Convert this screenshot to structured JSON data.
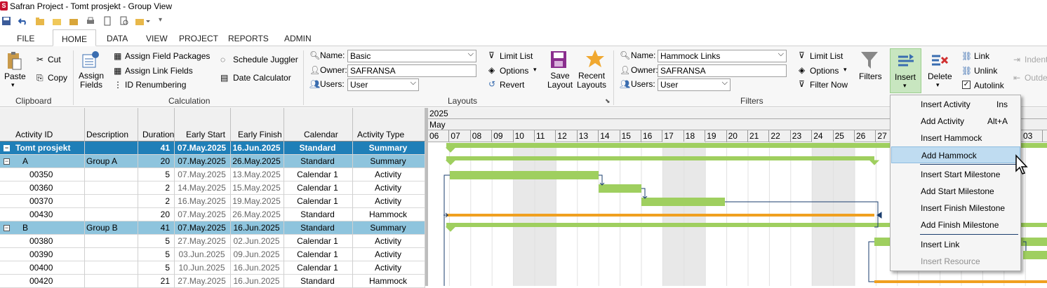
{
  "window": {
    "title": "Safran Project - Tomt prosjekt - Group View"
  },
  "tabs": [
    "FILE",
    "HOME",
    "DATA",
    "VIEW",
    "PROJECT",
    "REPORTS",
    "ADMIN"
  ],
  "active_tab": "HOME",
  "ribbon": {
    "clipboard": {
      "paste": "Paste",
      "cut": "Cut",
      "copy": "Copy",
      "group": "Clipboard"
    },
    "calculation": {
      "assign_fields": "Assign\nFields",
      "assign_field_packages": "Assign Field Packages",
      "assign_link_fields": "Assign Link Fields",
      "id_renumbering": "ID Renumbering",
      "schedule_juggler": "Schedule Juggler",
      "date_calculator": "Date Calculator",
      "group": "Calculation"
    },
    "layouts": {
      "name_label": "Name:",
      "name_value": "Basic",
      "owner_label": "Owner:",
      "owner_value": "SAFRANSA",
      "users_label": "Users:",
      "users_value": "User",
      "limit_list": "Limit List",
      "options": "Options",
      "revert": "Revert",
      "save_layout": "Save\nLayout",
      "recent_layouts": "Recent\nLayouts",
      "group": "Layouts"
    },
    "filters": {
      "name_label": "Name:",
      "name_value": "Hammock Links",
      "owner_label": "Owner:",
      "owner_value": "SAFRANSA",
      "users_label": "Users:",
      "users_value": "User",
      "limit_list": "Limit List",
      "options": "Options",
      "filter_now": "Filter Now",
      "filters": "Filters",
      "group": "Filters"
    },
    "edit": {
      "insert": "Insert",
      "delete": "Delete",
      "link": "Link",
      "unlink": "Unlink",
      "autolink": "Autolink",
      "autolink_checked": true,
      "indent": "Indent",
      "outdent": "Outde"
    }
  },
  "table": {
    "columns": [
      "Activity ID",
      "Description",
      "Duration",
      "Early Start",
      "Early Finish",
      "Calendar",
      "Activity Type"
    ],
    "rows": [
      {
        "level": 0,
        "id": "Tomt prosjekt",
        "desc": "",
        "dur": "41",
        "start": "07.May.2025",
        "finish": "16.Jun.2025",
        "cal": "Standard",
        "type": "Summary"
      },
      {
        "level": 1,
        "id": "A",
        "desc": "Group A",
        "dur": "20",
        "start": "07.May.2025",
        "finish": "26.May.2025",
        "cal": "Standard",
        "type": "Summary"
      },
      {
        "level": 2,
        "id": "00350",
        "desc": "",
        "dur": "5",
        "start": "07.May.2025",
        "finish": "13.May.2025",
        "cal": "Calendar 1",
        "type": "Activity"
      },
      {
        "level": 2,
        "id": "00360",
        "desc": "",
        "dur": "2",
        "start": "14.May.2025",
        "finish": "15.May.2025",
        "cal": "Calendar 1",
        "type": "Activity"
      },
      {
        "level": 2,
        "id": "00370",
        "desc": "",
        "dur": "2",
        "start": "16.May.2025",
        "finish": "19.May.2025",
        "cal": "Calendar 1",
        "type": "Activity"
      },
      {
        "level": 2,
        "id": "00430",
        "desc": "",
        "dur": "20",
        "start": "07.May.2025",
        "finish": "26.May.2025",
        "cal": "Standard",
        "type": "Hammock"
      },
      {
        "level": 1,
        "id": "B",
        "desc": "Group B",
        "dur": "41",
        "start": "07.May.2025",
        "finish": "16.Jun.2025",
        "cal": "Standard",
        "type": "Summary"
      },
      {
        "level": 2,
        "id": "00380",
        "desc": "",
        "dur": "5",
        "start": "27.May.2025",
        "finish": "02.Jun.2025",
        "cal": "Calendar 1",
        "type": "Activity"
      },
      {
        "level": 2,
        "id": "00390",
        "desc": "",
        "dur": "5",
        "start": "03.Jun.2025",
        "finish": "09.Jun.2025",
        "cal": "Calendar 1",
        "type": "Activity"
      },
      {
        "level": 2,
        "id": "00400",
        "desc": "",
        "dur": "5",
        "start": "10.Jun.2025",
        "finish": "16.Jun.2025",
        "cal": "Calendar 1",
        "type": "Activity"
      },
      {
        "level": 2,
        "id": "00420",
        "desc": "",
        "dur": "21",
        "start": "27.May.2025",
        "finish": "16.Jun.2025",
        "cal": "Standard",
        "type": "Hammock"
      }
    ]
  },
  "gantt": {
    "year": "2025",
    "month": "May",
    "days": [
      "06",
      "07",
      "08",
      "09",
      "10",
      "11",
      "12",
      "13",
      "14",
      "15",
      "16",
      "17",
      "18",
      "19",
      "20",
      "21",
      "22",
      "23",
      "24",
      "25",
      "26",
      "27"
    ],
    "days_right": [
      "03"
    ]
  },
  "context_menu": {
    "items": [
      {
        "label": "Insert Activity",
        "shortcut": "Ins"
      },
      {
        "label": "Add Activity",
        "shortcut": "Alt+A"
      },
      {
        "label": "Insert Hammock",
        "shortcut": ""
      },
      {
        "label": "Add Hammock",
        "shortcut": "",
        "highlighted": true
      },
      {
        "label": "Insert Start Milestone",
        "shortcut": ""
      },
      {
        "label": "Add Start Milestone",
        "shortcut": ""
      },
      {
        "label": "Insert Finish Milestone",
        "shortcut": ""
      },
      {
        "label": "Add Finish Milestone",
        "shortcut": ""
      },
      {
        "label": "Insert Link",
        "shortcut": ""
      },
      {
        "label": "Insert Resource",
        "shortcut": "",
        "disabled": true
      }
    ]
  },
  "colors": {
    "summary_top": "#1f7fb8",
    "summary": "#8ec4dd",
    "bar": "#9fcf5f",
    "hammock": "#f0a020",
    "link": "#1a3d6e"
  }
}
